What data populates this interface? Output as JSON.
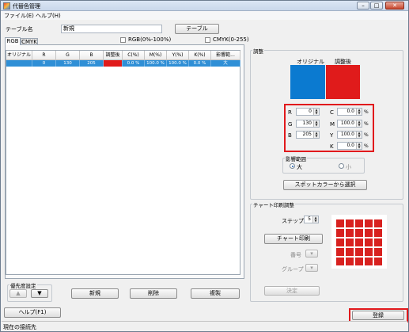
{
  "window": {
    "title": "代替色管理",
    "min": "–",
    "max": "□",
    "close": "✕"
  },
  "menu": [
    {
      "label": "ファイル(E)"
    },
    {
      "label": "ヘルプ(H)"
    }
  ],
  "table_name": {
    "label": "テーブル名",
    "value": "新規",
    "button": "テーブル"
  },
  "tabs": [
    {
      "label": "RGB"
    },
    {
      "label": "CMYK"
    }
  ],
  "checks": {
    "rgb": "RGB(0%-100%)",
    "cmyk": "CMYK(0-255)"
  },
  "grid": {
    "columns": [
      "オリジナル",
      "R",
      "G",
      "B",
      "調整後",
      "C(%)",
      "M(%)",
      "Y(%)",
      "K(%)",
      "影響範..."
    ],
    "row": [
      "",
      "0",
      "130",
      "205",
      "",
      "0.0 %",
      "100.0 %",
      "100.0 %",
      "0.0 %",
      "大"
    ]
  },
  "priority": {
    "title": "優先度設定",
    "up": "▲",
    "down": "▼"
  },
  "left_buttons": {
    "new": "新規",
    "delete": "削除",
    "duplicate": "複製"
  },
  "adjust": {
    "title": "調整",
    "original_label": "オリジナル",
    "adjusted_label": "調整後",
    "original_color": "#0b7ad0",
    "adjusted_color": "#e01b1b",
    "rgb": [
      {
        "label": "R",
        "value": "0"
      },
      {
        "label": "G",
        "value": "130"
      },
      {
        "label": "B",
        "value": "205"
      }
    ],
    "cmyk": [
      {
        "label": "C",
        "value": "0.0"
      },
      {
        "label": "M",
        "value": "100.0"
      },
      {
        "label": "Y",
        "value": "100.0"
      },
      {
        "label": "K",
        "value": "0.0"
      }
    ],
    "percent": "%",
    "range_title": "影響範囲",
    "range_large": "大",
    "range_small": "小",
    "spot_button": "スポットカラーから選択"
  },
  "chart": {
    "title": "チャート印刷調整",
    "step_label": "ステップ",
    "step_value": "5",
    "print_button": "チャート印刷",
    "number_label": "番号",
    "group_label": "グループ",
    "apply_button": "決定"
  },
  "bottom": {
    "help": "ヘルプ(F1)",
    "register": "登録"
  },
  "status": {
    "text": "現在の接続先"
  }
}
